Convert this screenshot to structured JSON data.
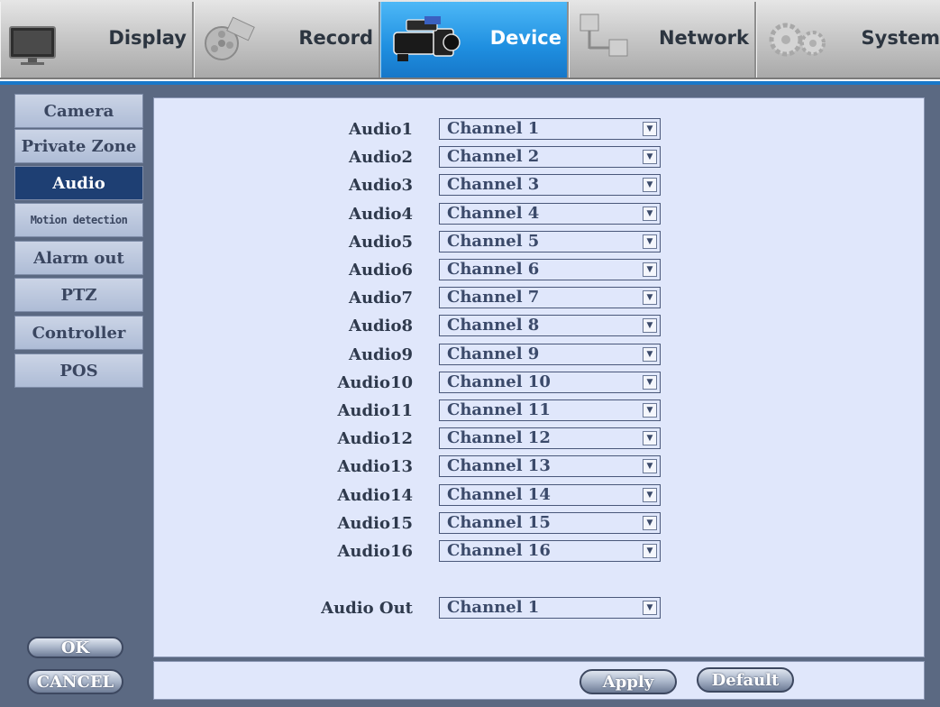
{
  "tabs": [
    {
      "label": "Display",
      "icon": "monitor-icon",
      "active": false
    },
    {
      "label": "Record",
      "icon": "film-reel-icon",
      "active": false
    },
    {
      "label": "Device",
      "icon": "camcorder-icon",
      "active": true
    },
    {
      "label": "Network",
      "icon": "network-icon",
      "active": false
    },
    {
      "label": "System",
      "icon": "gears-icon",
      "active": false
    }
  ],
  "sidebar": {
    "items": [
      {
        "label": "Camera"
      },
      {
        "label": "Private Zone"
      },
      {
        "label": "Audio",
        "active": true
      },
      {
        "label": "Motion detection"
      },
      {
        "label": "Alarm out"
      },
      {
        "label": "PTZ"
      },
      {
        "label": "Controller"
      },
      {
        "label": "POS"
      }
    ],
    "ok_label": "OK",
    "cancel_label": "CANCEL"
  },
  "audio": {
    "rows": [
      {
        "label": "Audio1",
        "value": "Channel 1"
      },
      {
        "label": "Audio2",
        "value": "Channel 2"
      },
      {
        "label": "Audio3",
        "value": "Channel 3"
      },
      {
        "label": "Audio4",
        "value": "Channel 4"
      },
      {
        "label": "Audio5",
        "value": "Channel 5"
      },
      {
        "label": "Audio6",
        "value": "Channel 6"
      },
      {
        "label": "Audio7",
        "value": "Channel 7"
      },
      {
        "label": "Audio8",
        "value": "Channel 8"
      },
      {
        "label": "Audio9",
        "value": "Channel 9"
      },
      {
        "label": "Audio10",
        "value": "Channel 10"
      },
      {
        "label": "Audio11",
        "value": "Channel 11"
      },
      {
        "label": "Audio12",
        "value": "Channel 12"
      },
      {
        "label": "Audio13",
        "value": "Channel 13"
      },
      {
        "label": "Audio14",
        "value": "Channel 14"
      },
      {
        "label": "Audio15",
        "value": "Channel 15"
      },
      {
        "label": "Audio16",
        "value": "Channel 16"
      }
    ],
    "out": {
      "label": "Audio Out",
      "value": "Channel 1"
    }
  },
  "footer": {
    "apply_label": "Apply",
    "default_label": "Default"
  },
  "colors": {
    "active_tab": "#1f8fe0",
    "active_sidebar": "#1e3f73",
    "panel_bg": "#e0e7fb",
    "frame_bg": "#5b6982"
  }
}
